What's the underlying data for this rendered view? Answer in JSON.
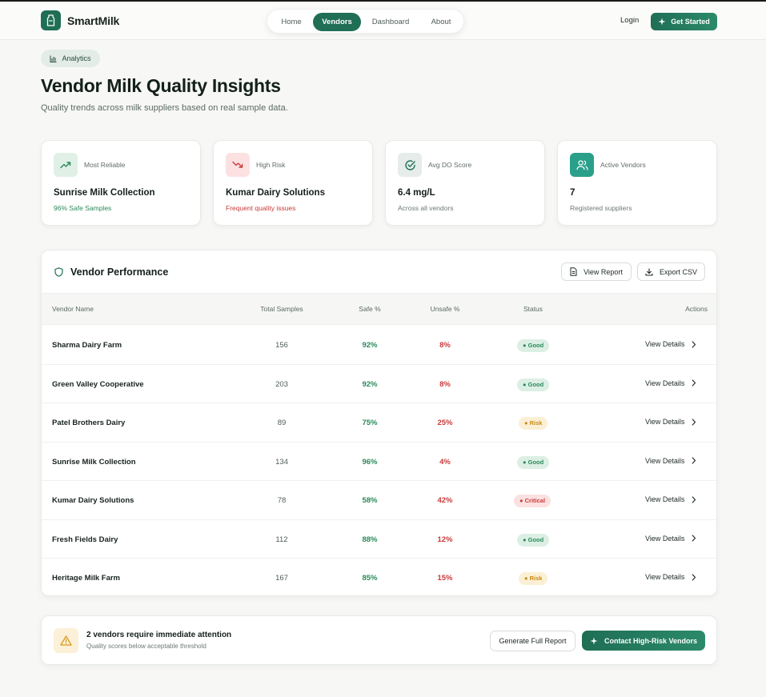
{
  "brand": {
    "name": "SmartMilk"
  },
  "nav": {
    "items": [
      {
        "label": "Home",
        "active": false
      },
      {
        "label": "Vendors",
        "active": true
      },
      {
        "label": "Dashboard",
        "active": false
      },
      {
        "label": "About",
        "active": false
      }
    ],
    "login_label": "Login",
    "cta_label": "Get Started"
  },
  "hero": {
    "pill_label": "Analytics",
    "title": "Vendor Milk Quality Insights",
    "subtitle": "Quality trends across milk suppliers based on real sample data."
  },
  "stats": [
    {
      "label": "Most Reliable",
      "value": "Sunrise Milk Collection",
      "note": "96% Safe Samples",
      "icon": "trending-up-icon",
      "accent": "#2b8a5a"
    },
    {
      "label": "High Risk",
      "value": "Kumar Dairy Solutions",
      "note": "Frequent quality issues",
      "icon": "trending-down-icon",
      "accent": "#c93b3b"
    },
    {
      "label": "Avg DO Score",
      "value": "6.4 mg/L",
      "note": "Across all vendors",
      "icon": "check-circle-icon",
      "accent": "#1f6e55"
    },
    {
      "label": "Active Vendors",
      "value": "7",
      "note": "Registered suppliers",
      "icon": "users-icon",
      "accent": "#2aa08a"
    }
  ],
  "table": {
    "title": "Vendor Performance",
    "view_report_label": "View Report",
    "export_label": "Export CSV",
    "columns": [
      "Vendor Name",
      "Total Samples",
      "Safe %",
      "Unsafe %",
      "Status",
      "Actions"
    ],
    "action_label": "View Details",
    "rows": [
      {
        "name": "Sharma Dairy Farm",
        "total": "156",
        "safe": "92%",
        "unsafe": "8%",
        "status": "Good",
        "status_kind": "good"
      },
      {
        "name": "Green Valley Cooperative",
        "total": "203",
        "safe": "92%",
        "unsafe": "8%",
        "status": "Good",
        "status_kind": "good"
      },
      {
        "name": "Patel Brothers Dairy",
        "total": "89",
        "safe": "75%",
        "unsafe": "25%",
        "status": "Risk",
        "status_kind": "risk"
      },
      {
        "name": "Sunrise Milk Collection",
        "total": "134",
        "safe": "96%",
        "unsafe": "4%",
        "status": "Good",
        "status_kind": "good"
      },
      {
        "name": "Kumar Dairy Solutions",
        "total": "78",
        "safe": "58%",
        "unsafe": "42%",
        "status": "Critical",
        "status_kind": "critical"
      },
      {
        "name": "Fresh Fields Dairy",
        "total": "112",
        "safe": "88%",
        "unsafe": "12%",
        "status": "Good",
        "status_kind": "good"
      },
      {
        "name": "Heritage Milk Farm",
        "total": "167",
        "safe": "85%",
        "unsafe": "15%",
        "status": "Risk",
        "status_kind": "risk"
      }
    ]
  },
  "alert": {
    "title": "2 vendors require immediate attention",
    "subtitle": "Quality scores below acceptable threshold",
    "secondary_label": "Generate Full Report",
    "primary_label": "Contact High-Risk Vendors"
  },
  "colors": {
    "brand": "#1f6e55",
    "safe": "#2b8a5a",
    "unsafe": "#c93b3b",
    "warning": "#c98a18"
  }
}
